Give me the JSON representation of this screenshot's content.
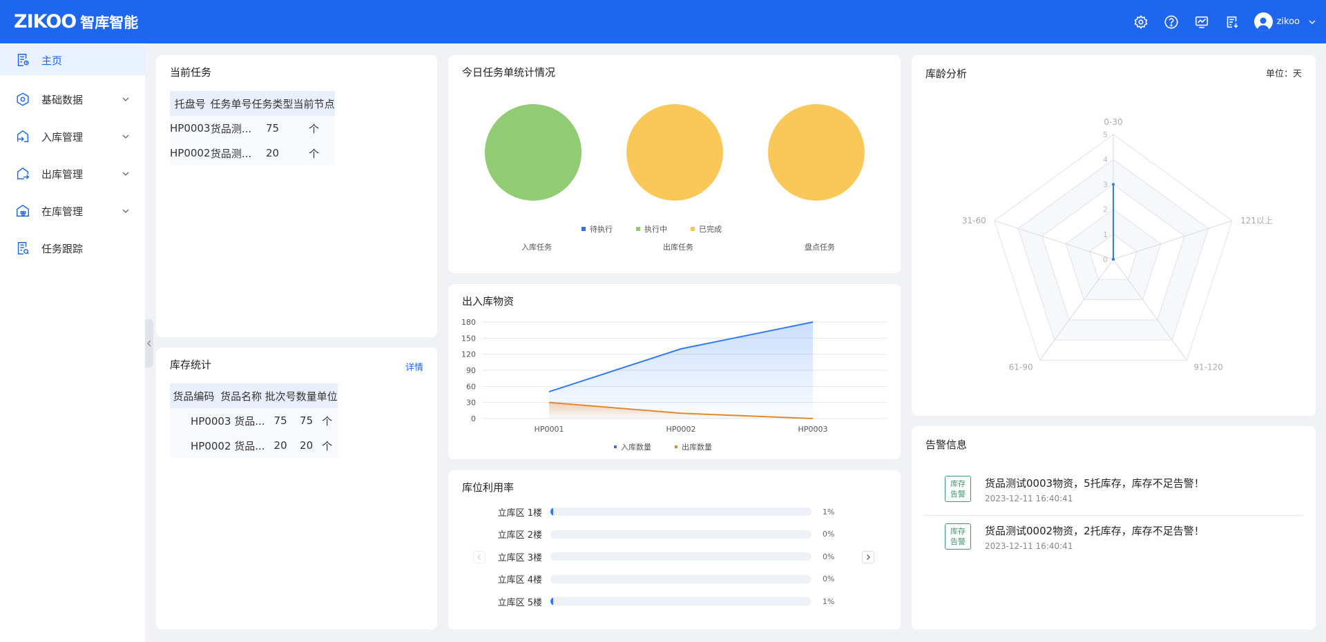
{
  "header": {
    "brand": "ZIKOO",
    "brand_cn": "智库智能",
    "icons": [
      "gear-icon",
      "help-icon",
      "monitor-icon",
      "document-icon"
    ],
    "user": "zikoo",
    "bg_color": "#1f66ee"
  },
  "sidebar": {
    "items": [
      {
        "label": "主页",
        "icon": "home-doc-icon",
        "active": true,
        "expandable": false
      },
      {
        "label": "基础数据",
        "icon": "hexagon-icon",
        "active": false,
        "expandable": true
      },
      {
        "label": "入库管理",
        "icon": "inbound-icon",
        "active": false,
        "expandable": true
      },
      {
        "label": "出库管理",
        "icon": "outbound-icon",
        "active": false,
        "expandable": true
      },
      {
        "label": "在库管理",
        "icon": "warehouse-icon",
        "active": false,
        "expandable": true
      },
      {
        "label": "任务跟踪",
        "icon": "task-track-icon",
        "active": false,
        "expandable": false
      }
    ]
  },
  "current_tasks": {
    "title": "当前任务",
    "columns": [
      "托盘号",
      "任务单号",
      "任务类型",
      "当前节点"
    ],
    "rows": [
      [
        "HP0003",
        "货品测...",
        "75",
        "个"
      ],
      [
        "HP0002",
        "货品测...",
        "20",
        "个"
      ]
    ]
  },
  "inventory": {
    "title": "库存统计",
    "link": "详情",
    "columns": [
      "货品编码",
      "货品名称",
      "批次号",
      "数量",
      "单位"
    ],
    "rows": [
      [
        "HP0003 货品...",
        "75",
        "75",
        "个"
      ],
      [
        "HP0002 货品...",
        "20",
        "20",
        "个"
      ]
    ]
  },
  "today_tasks": {
    "title": "今日任务单统计情况",
    "legend": [
      {
        "label": "待执行",
        "color": "#3a6fd8"
      },
      {
        "label": "执行中",
        "color": "#91cc75"
      },
      {
        "label": "已完成",
        "color": "#fac858"
      }
    ],
    "pies": [
      {
        "label": "入库任务",
        "color": "#91cc75"
      },
      {
        "label": "出库任务",
        "color": "#fac858"
      },
      {
        "label": "盘点任务",
        "color": "#fac858"
      }
    ]
  },
  "io_materials": {
    "title": "出入库物资",
    "legend": [
      {
        "label": "入库数量",
        "color": "#3a6fd8"
      },
      {
        "label": "出库数量",
        "color": "#e08a2c"
      }
    ]
  },
  "utilization": {
    "title": "库位利用率",
    "rows": [
      {
        "label": "立库区 1楼",
        "value": "1%",
        "fraction": 0.01
      },
      {
        "label": "立库区 2楼",
        "value": "0%",
        "fraction": 0
      },
      {
        "label": "立库区 3楼",
        "value": "0%",
        "fraction": 0
      },
      {
        "label": "立库区 4楼",
        "value": "0%",
        "fraction": 0
      },
      {
        "label": "立库区 5楼",
        "value": "1%",
        "fraction": 0.01
      }
    ]
  },
  "age_analysis": {
    "title": "库龄分析",
    "unit": "单位：天"
  },
  "alerts": {
    "title": "告警信息",
    "items": [
      {
        "tag": "库存告警",
        "tag_top": "库存",
        "tag_bottom": "告警",
        "message": "货品测试0003物资，5托库存，库存不足告警！",
        "time": "2023-12-11 16:40:41"
      },
      {
        "tag": "库存告警",
        "tag_top": "库存",
        "tag_bottom": "告警",
        "message": "货品测试0002物资，2托库存，库存不足告警！",
        "time": "2023-12-11 16:40:41"
      }
    ]
  },
  "chart_data": [
    {
      "type": "line",
      "title": "出入库物资",
      "categories": [
        "HP0001",
        "HP0002",
        "HP0003"
      ],
      "ylim": [
        0,
        180
      ],
      "yticks": [
        0,
        30,
        60,
        90,
        120,
        150,
        180
      ],
      "series": [
        {
          "name": "入库数量",
          "values": [
            50,
            130,
            180
          ],
          "color": "#2f7bf5",
          "area": true
        },
        {
          "name": "出库数量",
          "values": [
            30,
            10,
            0
          ],
          "color": "#e08a2c",
          "area": true
        }
      ],
      "grid": true,
      "legend_position": "bottom"
    },
    {
      "type": "radar",
      "title": "库龄分析",
      "indicators": [
        "0-30",
        "121以上",
        "91-120",
        "61-90",
        "31-60"
      ],
      "max": 5,
      "ticks": [
        0,
        1,
        2,
        3,
        4,
        5
      ],
      "series": [
        {
          "name": "",
          "values": [
            3,
            0,
            0,
            0,
            0
          ],
          "color": "#2f7bf5"
        }
      ]
    },
    {
      "type": "pie",
      "title": "今日任务单统计情况",
      "legend": [
        "待执行",
        "执行中",
        "已完成"
      ],
      "pies": [
        {
          "name": "入库任务",
          "slices": [
            {
              "label": "执行中",
              "value": 1
            }
          ]
        },
        {
          "name": "出库任务",
          "slices": [
            {
              "label": "已完成",
              "value": 1
            }
          ]
        },
        {
          "name": "盘点任务",
          "slices": [
            {
              "label": "已完成",
              "value": 1
            }
          ]
        }
      ]
    }
  ]
}
